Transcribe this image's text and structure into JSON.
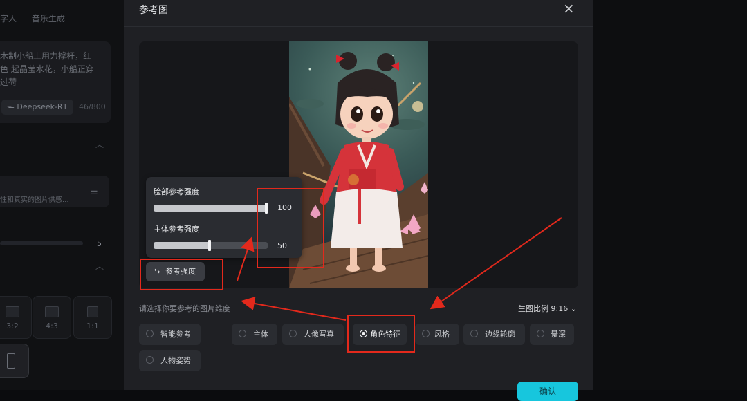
{
  "background": {
    "tabs": [
      "字人",
      "音乐生成"
    ],
    "prompt_text": "木制小船上用力撑杆，红色 起晶莹水花，小船正穿过荷",
    "model_label": "Deepseek-R1",
    "char_count": "46/800",
    "filter_text": "性和真实的图片供感...",
    "slider_value": "5",
    "ratio_tiles": [
      "3:2",
      "4:3",
      "1:1"
    ]
  },
  "dialog": {
    "title": "参考图",
    "close_icon": "×",
    "face_strength": {
      "label": "脸部参考强度",
      "value": "100",
      "level": 1.0
    },
    "body_strength": {
      "label": "主体参考强度",
      "value": "50",
      "level": 0.5
    },
    "strength_button": "参考强度",
    "dimension_hint": "请选择你要参考的图片维度",
    "ratio_selector": "生图比例 9:16",
    "options": [
      "智能参考",
      "主体",
      "人像写真",
      "角色特征",
      "风格",
      "边缘轮廓",
      "景深",
      "人物姿势"
    ],
    "selected_option": "角色特征",
    "confirm_label": "确认"
  },
  "colors": {
    "accent": "#17c6dd",
    "annotation": "#e3291c",
    "dialog_bg": "#1f2024"
  }
}
